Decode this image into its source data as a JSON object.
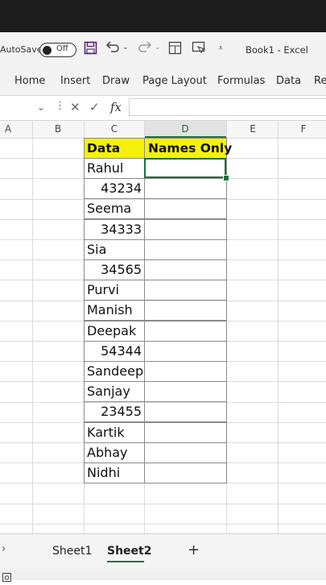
{
  "titlebar": {
    "autosave_label": "AutoSave",
    "autosave_state": "Off",
    "book_title": "Book1 - Excel"
  },
  "ribbon": {
    "tabs": [
      "Home",
      "Insert",
      "Draw",
      "Page Layout",
      "Formulas",
      "Data",
      "Re"
    ]
  },
  "formula_bar": {
    "fx_label": "fx",
    "value": ""
  },
  "columns": [
    "A",
    "B",
    "C",
    "D",
    "E",
    "F"
  ],
  "sheet": {
    "header": {
      "data": "Data",
      "names_only": "Names Only"
    },
    "rows": [
      {
        "value": "Rahul",
        "kind": "text"
      },
      {
        "value": "43234",
        "kind": "num"
      },
      {
        "value": "Seema",
        "kind": "text"
      },
      {
        "value": "34333",
        "kind": "num"
      },
      {
        "value": "Sia",
        "kind": "text"
      },
      {
        "value": "34565",
        "kind": "num"
      },
      {
        "value": "Purvi",
        "kind": "text"
      },
      {
        "value": "Manish",
        "kind": "text"
      },
      {
        "value": "Deepak",
        "kind": "text"
      },
      {
        "value": "54344",
        "kind": "num"
      },
      {
        "value": "Sandeep",
        "kind": "text"
      },
      {
        "value": "Sanjay",
        "kind": "text"
      },
      {
        "value": "23455",
        "kind": "num"
      },
      {
        "value": "Kartik",
        "kind": "text"
      },
      {
        "value": "Abhay",
        "kind": "text"
      },
      {
        "value": "Nidhi",
        "kind": "text"
      }
    ]
  },
  "sheet_tabs": {
    "tabs": [
      "Sheet1",
      "Sheet2"
    ],
    "active": "Sheet2",
    "add_label": "+"
  },
  "colors": {
    "header_fill": "#f5f10a",
    "accent": "#217346"
  }
}
